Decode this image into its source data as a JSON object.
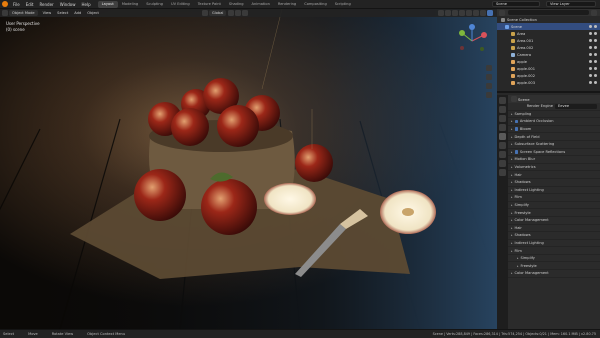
{
  "menu": [
    "File",
    "Edit",
    "Render",
    "Window",
    "Help"
  ],
  "workspaces": [
    {
      "label": "Layout",
      "active": true
    },
    {
      "label": "Modeling",
      "active": false
    },
    {
      "label": "Sculpting",
      "active": false
    },
    {
      "label": "UV Editing",
      "active": false
    },
    {
      "label": "Texture Paint",
      "active": false
    },
    {
      "label": "Shading",
      "active": false
    },
    {
      "label": "Animation",
      "active": false
    },
    {
      "label": "Rendering",
      "active": false
    },
    {
      "label": "Compositing",
      "active": false
    },
    {
      "label": "Scripting",
      "active": false
    }
  ],
  "scene_field": "Scene",
  "view_layer_field": "View Layer",
  "viewport": {
    "mode": "Object Mode",
    "menus": [
      "View",
      "Select",
      "Add",
      "Object"
    ],
    "orientation": "Global",
    "perspective_label": "User Perspective",
    "collection_label": "(0) scene"
  },
  "outliner": {
    "root": "Scene Collection",
    "items": [
      {
        "label": "Scene",
        "selected": true,
        "color": "#6fa0e8"
      },
      {
        "label": "Area",
        "selected": false,
        "color": "#c9a24b"
      },
      {
        "label": "Area.001",
        "selected": false,
        "color": "#c9a24b"
      },
      {
        "label": "Area.002",
        "selected": false,
        "color": "#c9a24b"
      },
      {
        "label": "Camera",
        "selected": false,
        "color": "#8fb2d8"
      },
      {
        "label": "apple",
        "selected": false,
        "color": "#e0a45a"
      },
      {
        "label": "apple.001",
        "selected": false,
        "color": "#e0a45a"
      },
      {
        "label": "apple.002",
        "selected": false,
        "color": "#e0a45a"
      },
      {
        "label": "apple.003",
        "selected": false,
        "color": "#e0a45a"
      }
    ]
  },
  "properties": {
    "context": "Scene",
    "render_engine_label": "Render Engine",
    "render_engine_value": "Eevee",
    "rows": [
      {
        "label": "Sampling",
        "check": false,
        "sub": false
      },
      {
        "label": "Ambient Occlusion",
        "check": true,
        "sub": false
      },
      {
        "label": "Bloom",
        "check": true,
        "sub": false
      },
      {
        "label": "Depth of Field",
        "check": false,
        "sub": false
      },
      {
        "label": "Subsurface Scattering",
        "check": false,
        "sub": false
      },
      {
        "label": "Screen Space Reflections",
        "check": true,
        "sub": false
      },
      {
        "label": "Motion Blur",
        "check": false,
        "sub": false
      },
      {
        "label": "Volumetrics",
        "check": false,
        "sub": false
      },
      {
        "label": "Hair",
        "check": false,
        "sub": false
      },
      {
        "label": "Shadows",
        "check": false,
        "sub": false
      },
      {
        "label": "Indirect Lighting",
        "check": false,
        "sub": false
      },
      {
        "label": "Film",
        "check": false,
        "sub": false
      },
      {
        "label": "Simplify",
        "check": false,
        "sub": false
      },
      {
        "label": "Freestyle",
        "check": false,
        "sub": false
      },
      {
        "label": "Color Management",
        "check": false,
        "sub": false
      },
      {
        "label": "Hair",
        "check": false,
        "sub": false
      },
      {
        "label": "Shadows",
        "check": false,
        "sub": false
      },
      {
        "label": "Indirect Lighting",
        "check": false,
        "sub": false
      },
      {
        "label": "Film",
        "check": false,
        "sub": false
      },
      {
        "label": "Simplify",
        "check": false,
        "sub": true
      },
      {
        "label": "Freestyle",
        "check": false,
        "sub": true
      },
      {
        "label": "Color Management",
        "check": false,
        "sub": false
      }
    ]
  },
  "status": {
    "select": "Select",
    "move": "Move",
    "rotate": "Rotate View",
    "context": "Object Context Menu",
    "right": "Scene | Verts:288,849 | Faces:286,314 | Tris:574,254 | Objects:0/21 | Mem: 160.1 MiB | v2.80.75"
  }
}
